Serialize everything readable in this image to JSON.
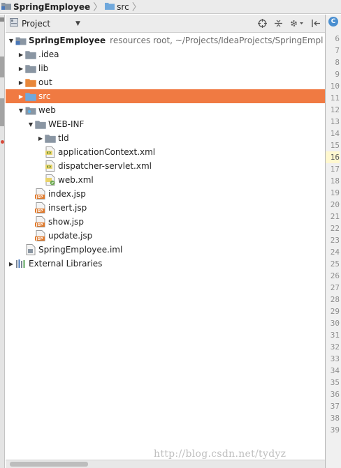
{
  "breadcrumb": {
    "project": "SpringEmployee",
    "folder": "src"
  },
  "toolwindow": {
    "title": "Project",
    "tools": [
      "target-icon",
      "collapse-icon",
      "gear-icon",
      "hide-icon"
    ]
  },
  "tree": [
    {
      "name": "SpringEmployee",
      "meta": "resources root,  ~/Projects/IdeaProjects/SpringEmpl",
      "depth": 0,
      "arrow": "down",
      "icon": "module-folder",
      "bold": true
    },
    {
      "name": ".idea",
      "depth": 1,
      "arrow": "right",
      "icon": "folder"
    },
    {
      "name": "lib",
      "depth": 1,
      "arrow": "right",
      "icon": "folder"
    },
    {
      "name": "out",
      "depth": 1,
      "arrow": "right",
      "icon": "excluded-folder"
    },
    {
      "name": "src",
      "depth": 1,
      "arrow": "right",
      "icon": "source-folder",
      "selected": true
    },
    {
      "name": "web",
      "depth": 1,
      "arrow": "down",
      "icon": "web-folder"
    },
    {
      "name": "WEB-INF",
      "depth": 2,
      "arrow": "down",
      "icon": "folder"
    },
    {
      "name": "tld",
      "depth": 3,
      "arrow": "right",
      "icon": "folder"
    },
    {
      "name": "applicationContext.xml",
      "depth": 3,
      "arrow": "",
      "icon": "xml-file"
    },
    {
      "name": "dispatcher-servlet.xml",
      "depth": 3,
      "arrow": "",
      "icon": "xml-file"
    },
    {
      "name": "web.xml",
      "depth": 3,
      "arrow": "",
      "icon": "web-xml-file"
    },
    {
      "name": "index.jsp",
      "depth": 2,
      "arrow": "",
      "icon": "jsp-file"
    },
    {
      "name": "insert.jsp",
      "depth": 2,
      "arrow": "",
      "icon": "jsp-file"
    },
    {
      "name": "show.jsp",
      "depth": 2,
      "arrow": "",
      "icon": "jsp-file"
    },
    {
      "name": "update.jsp",
      "depth": 2,
      "arrow": "",
      "icon": "jsp-file"
    },
    {
      "name": "SpringEmployee.iml",
      "depth": 1,
      "arrow": "",
      "icon": "iml-file"
    },
    {
      "name": "External Libraries",
      "depth": 0,
      "arrow": "right",
      "icon": "libraries"
    }
  ],
  "gutter": {
    "tab_letter": "C",
    "highlighted_line": "16",
    "line_numbers": [
      "6",
      "7",
      "8",
      "9",
      "10",
      "11",
      "12",
      "13",
      "14",
      "15",
      "16",
      "17",
      "18",
      "19",
      "20",
      "21",
      "22",
      "23",
      "24",
      "25",
      "26",
      "27",
      "28",
      "29",
      "30",
      "31",
      "32",
      "33",
      "34",
      "35",
      "36",
      "37",
      "38",
      "39"
    ]
  },
  "watermark": "http://blog.csdn.net/tydyz",
  "colors": {
    "selection": "#f07a42",
    "folder": "#8a96a3",
    "source_folder": "#6fa8dc",
    "excluded_folder": "#e8873a",
    "jsp": "#e07a2c"
  }
}
